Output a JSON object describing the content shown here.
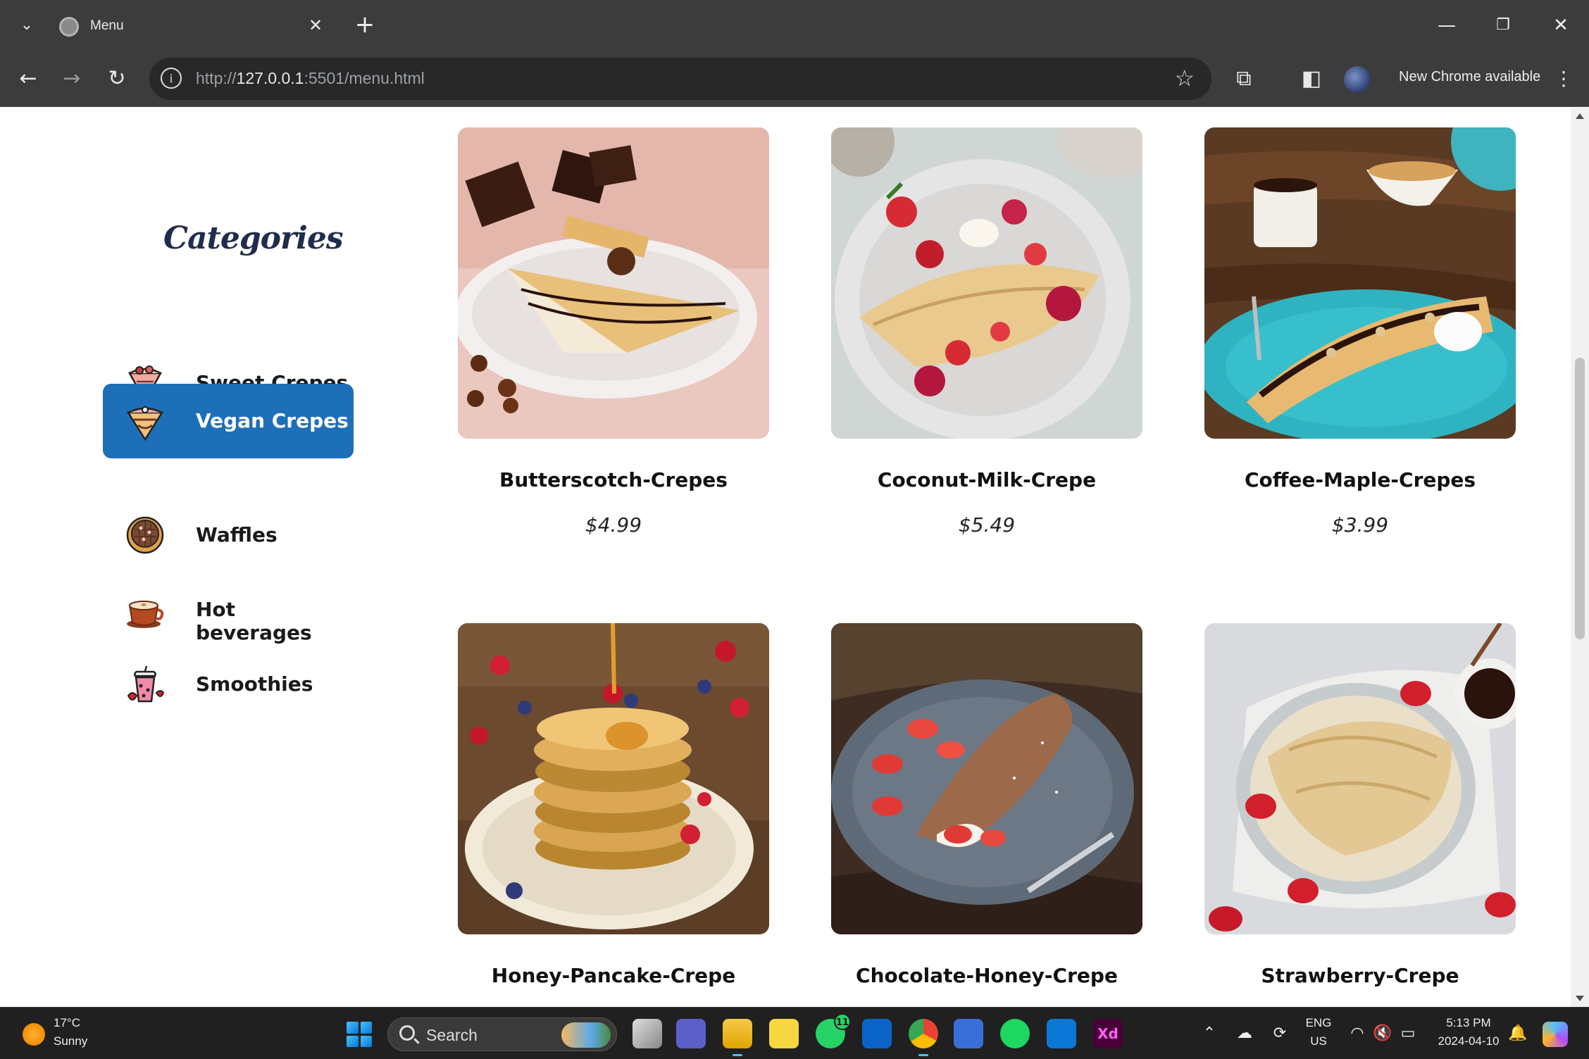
{
  "browser": {
    "tab_title": "Menu",
    "url_scheme": "http://",
    "url_host": "127.0.0.1",
    "url_rest": ":5501/menu.html",
    "update_label": "New Chrome available"
  },
  "sidebar": {
    "title": "Categories",
    "items": [
      {
        "label": "Sweet Crepes",
        "icon": "crepe-cone-icon",
        "active": false
      },
      {
        "label": "Vegan Crepes",
        "icon": "vegan-crepe-icon",
        "active": true
      },
      {
        "label": "Waffles",
        "icon": "waffle-icon",
        "active": false
      },
      {
        "label": "Hot beverages",
        "icon": "coffee-cup-icon",
        "active": false
      },
      {
        "label": "Smoothies",
        "icon": "smoothie-cup-icon",
        "active": false
      }
    ]
  },
  "products": [
    {
      "name": "Butterscotch-Crepes",
      "price": "$4.99"
    },
    {
      "name": "Coconut-Milk-Crepe",
      "price": "$5.49"
    },
    {
      "name": "Coffee-Maple-Crepes",
      "price": "$3.99"
    },
    {
      "name": "Honey-Pancake-Crepe",
      "price": ""
    },
    {
      "name": "Chocolate-Honey-Crepe",
      "price": ""
    },
    {
      "name": "Strawberry-Crepe",
      "price": ""
    }
  ],
  "colors": {
    "active_category_bg": "#1d6fb8",
    "title_color": "#1f2d4d",
    "chrome_bg": "#3c3c3c",
    "taskbar_bg": "#202020"
  },
  "taskbar": {
    "weather_temp": "17°C",
    "weather_condition": "Sunny",
    "search_label": "Search",
    "whatsapp_badge": "11",
    "language_top": "ENG",
    "language_bottom": "US",
    "time": "5:13 PM",
    "date": "2024-04-10"
  }
}
